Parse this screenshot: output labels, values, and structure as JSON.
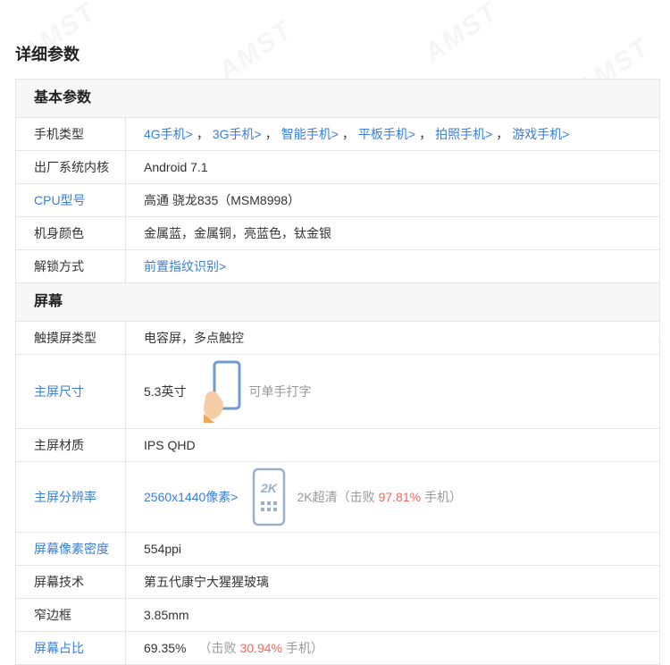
{
  "page_title": "详细参数",
  "sections": [
    {
      "title": "基本参数",
      "rows": [
        {
          "label": "手机类型",
          "links": [
            "4G手机>",
            "3G手机>",
            "智能手机>",
            "平板手机>",
            "拍照手机>",
            "游戏手机>"
          ],
          "separator": "，"
        },
        {
          "label": "出厂系统内核",
          "value": "Android 7.1"
        },
        {
          "label": "CPU型号",
          "value": "高通 骁龙835（MSM8998）"
        },
        {
          "label": "机身颜色",
          "value": "金属蓝，金属铜，亮蓝色，钛金银"
        },
        {
          "label": "解锁方式",
          "link_value": "前置指纹识别>"
        }
      ]
    },
    {
      "title": "屏幕",
      "rows": [
        {
          "label": "触摸屏类型",
          "value": "电容屏，多点触控"
        },
        {
          "label": "主屏尺寸",
          "value": "5.3英寸",
          "note": "可单手打字",
          "icon": "phone-in-hand-icon"
        },
        {
          "label": "主屏材质",
          "value": "IPS QHD"
        },
        {
          "label": "主屏分辨率",
          "link_value": "2560x1440像素>",
          "icon": "2k-phone-icon",
          "icon_text": "2K",
          "note_prefix": "2K超清（击败",
          "note_highlight": "97.81%",
          "note_suffix": "手机）"
        },
        {
          "label": "屏幕像素密度",
          "value": "554ppi"
        },
        {
          "label": "屏幕技术",
          "value": "第五代康宁大猩猩玻璃"
        },
        {
          "label": "窄边框",
          "value": "3.85mm"
        },
        {
          "label": "屏幕占比",
          "value": "69.35%",
          "note_prefix": "（击败",
          "note_highlight": "30.94%",
          "note_suffix": "手机）"
        }
      ]
    }
  ],
  "colors": {
    "link": "#3a7fd5",
    "highlight": "#ef6a5b",
    "muted": "#999999",
    "section_bg": "#f7f7f7",
    "border": "#e6e6e6"
  }
}
